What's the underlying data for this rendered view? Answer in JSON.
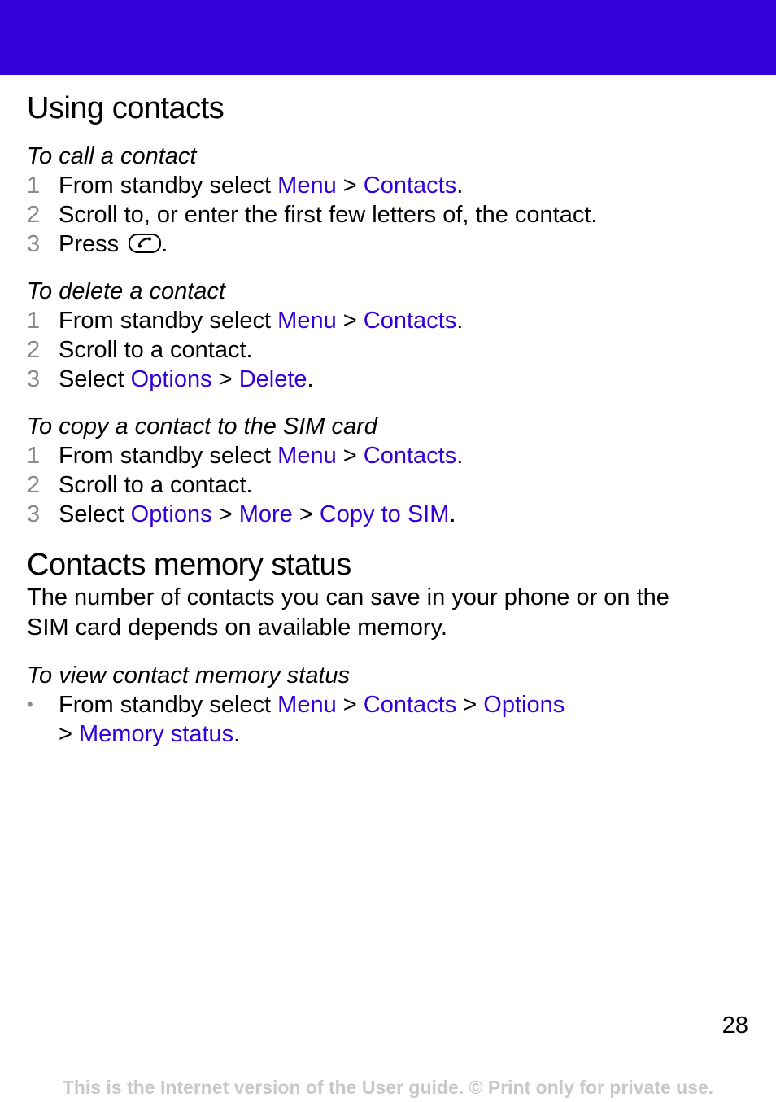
{
  "header": {
    "band_color": "#3300d9"
  },
  "section1": {
    "title": "Using contacts",
    "procedures": [
      {
        "title": "To call a contact",
        "steps": [
          {
            "num": "1",
            "pre": "From standby select ",
            "link1": "Menu",
            "sep1": " > ",
            "link2": "Contacts",
            "end": "."
          },
          {
            "num": "2",
            "text": "Scroll to, or enter the first few letters of, the contact."
          },
          {
            "num": "3",
            "pre": "Press ",
            "icon": "call-key-icon",
            "end": "."
          }
        ]
      },
      {
        "title": "To delete a contact",
        "steps": [
          {
            "num": "1",
            "pre": "From standby select ",
            "link1": "Menu",
            "sep1": " > ",
            "link2": "Contacts",
            "end": "."
          },
          {
            "num": "2",
            "text": "Scroll to a contact."
          },
          {
            "num": "3",
            "pre": "Select ",
            "link1": "Options",
            "sep1": " > ",
            "link2": "Delete",
            "end": "."
          }
        ]
      },
      {
        "title": "To copy a contact to the SIM card",
        "steps": [
          {
            "num": "1",
            "pre": "From standby select ",
            "link1": "Menu",
            "sep1": " > ",
            "link2": "Contacts",
            "end": "."
          },
          {
            "num": "2",
            "text": "Scroll to a contact."
          },
          {
            "num": "3",
            "pre": "Select ",
            "link1": "Options",
            "sep1": " > ",
            "link2": "More",
            "sep2": " > ",
            "link3": "Copy to SIM",
            "end": "."
          }
        ]
      }
    ]
  },
  "section2": {
    "title": "Contacts memory status",
    "paragraph_line1": "The number of contacts you can save in your phone or on the",
    "paragraph_line2": "SIM card depends on available memory.",
    "procedure": {
      "title": "To view contact memory status",
      "bullet": "•",
      "pre": "From standby select ",
      "link1": "Menu",
      "sep1": " > ",
      "link2": "Contacts",
      "sep2": " > ",
      "link3": "Options",
      "line2_sep": "> ",
      "link4": "Memory status",
      "end": "."
    }
  },
  "page_number": "28",
  "footer": "This is the Internet version of the User guide. © Print only for private use."
}
